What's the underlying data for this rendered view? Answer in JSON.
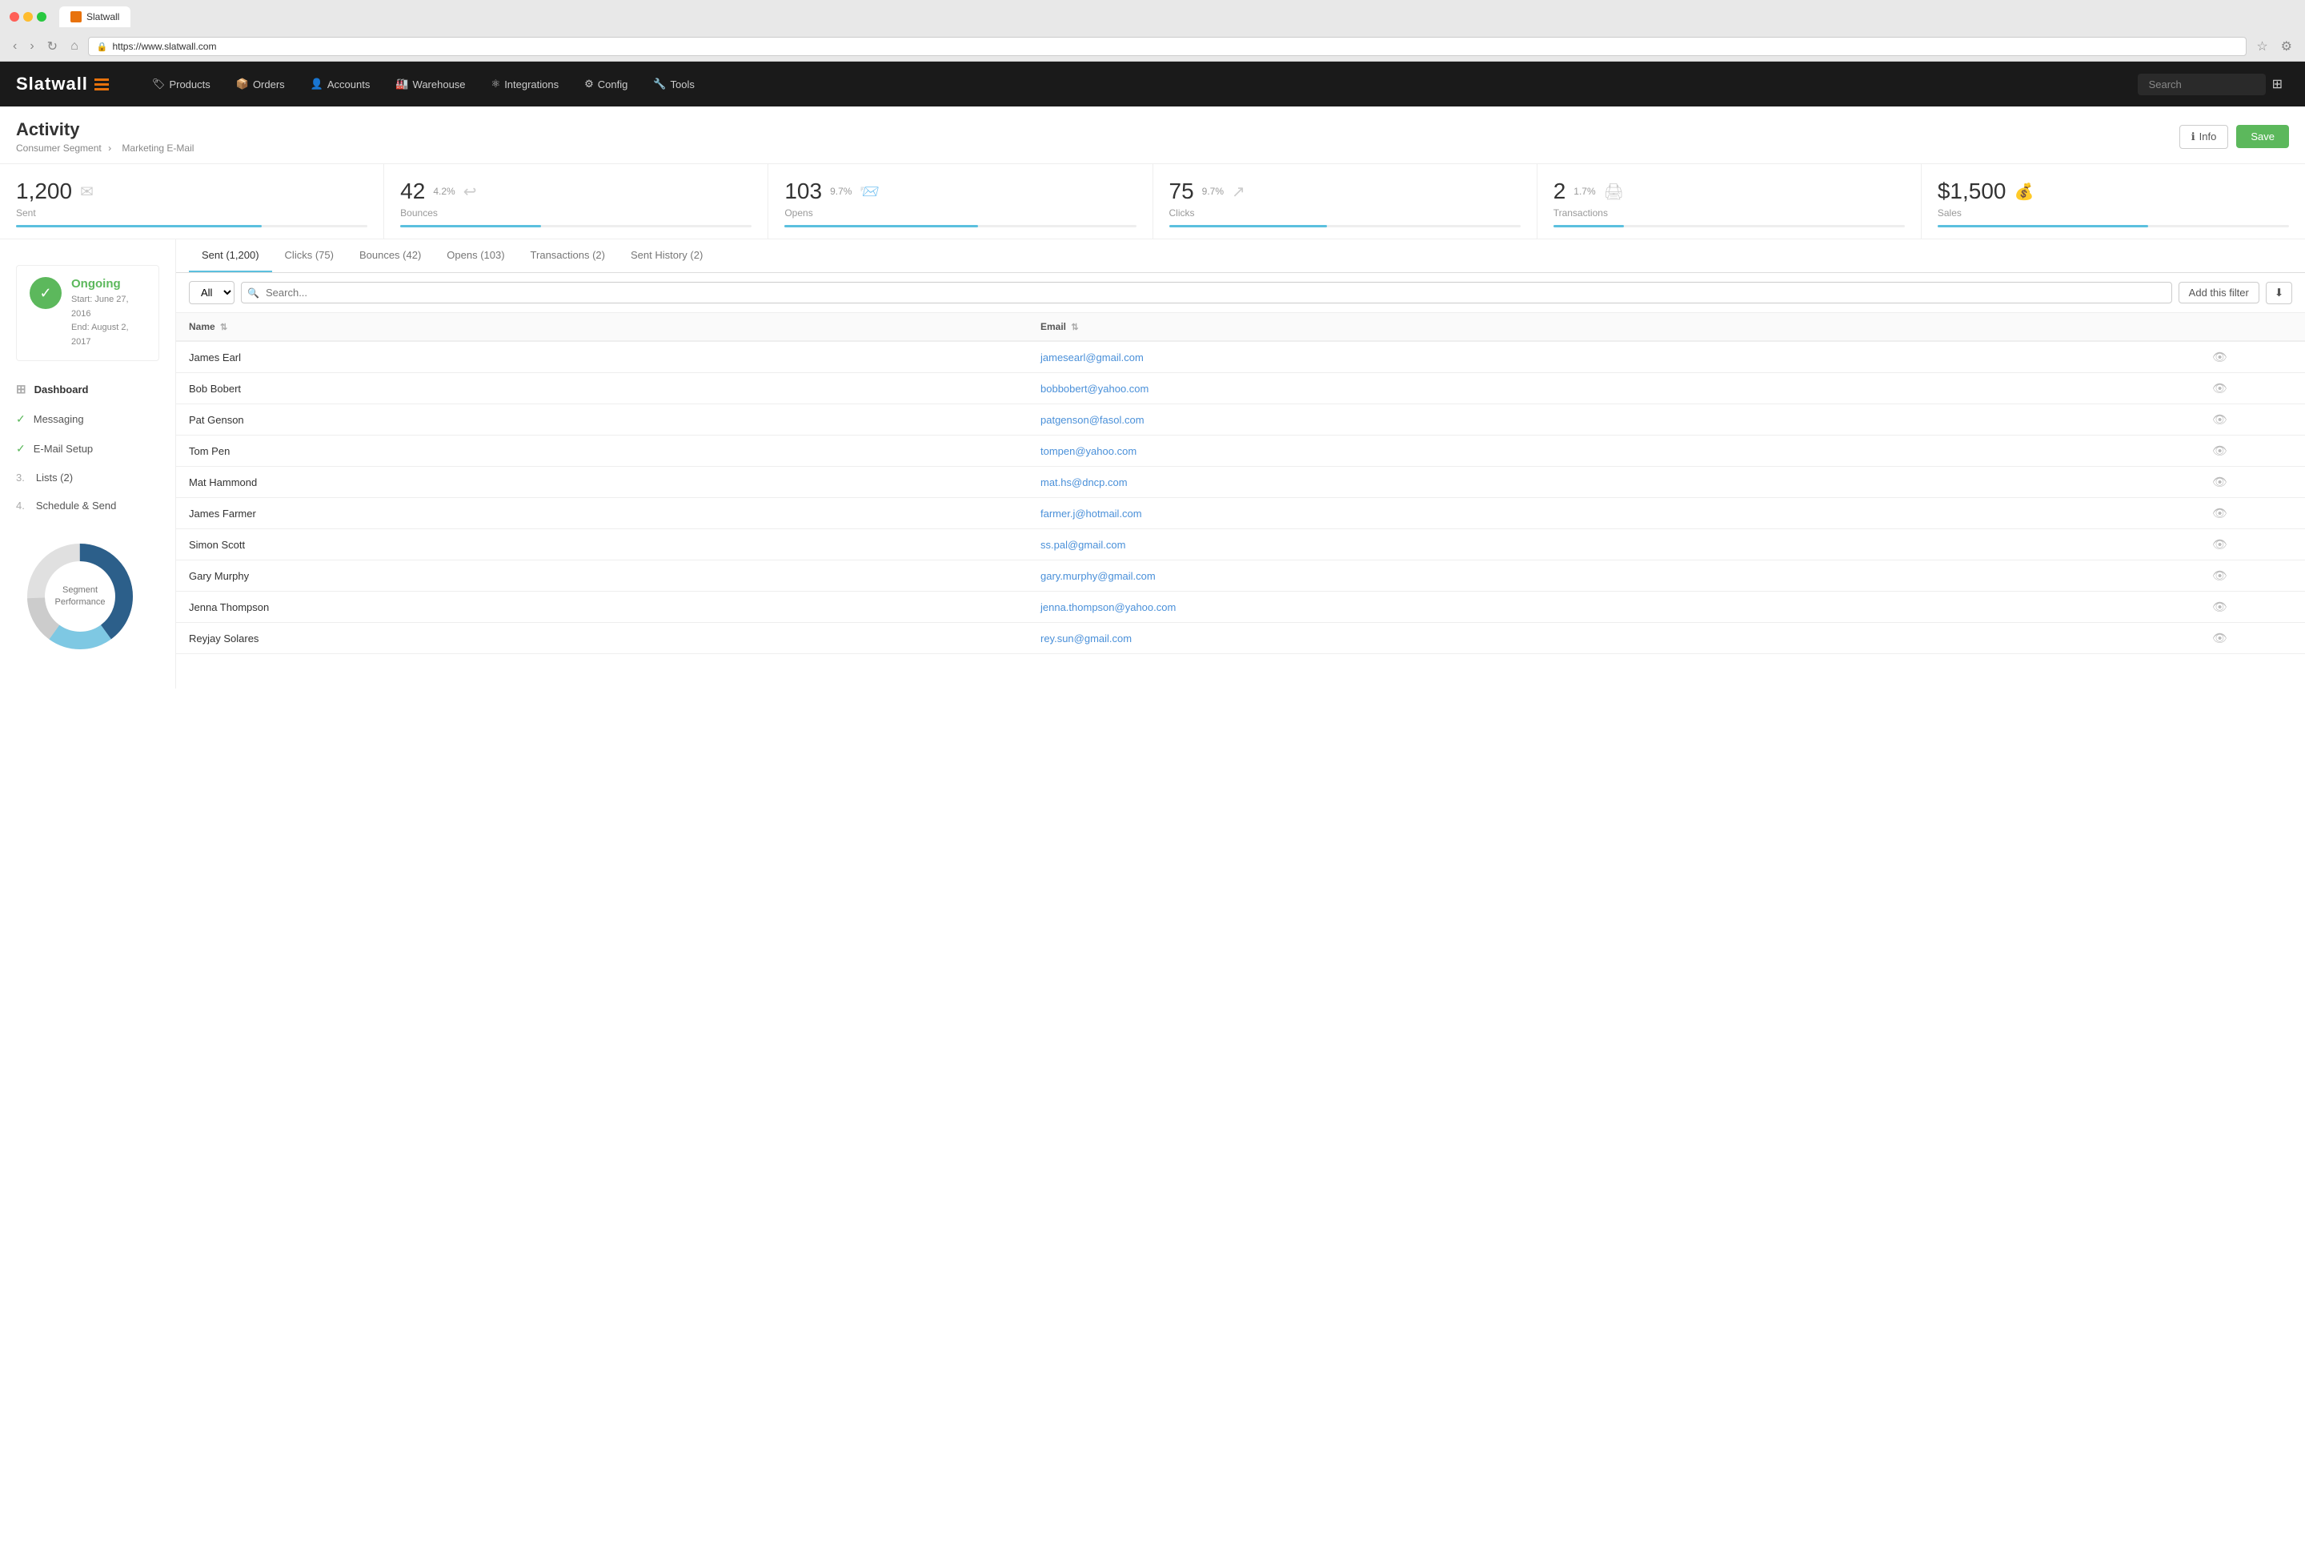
{
  "browser": {
    "url": "https://www.slatwall.com",
    "tab_title": "Slatwall"
  },
  "navbar": {
    "brand": "Slatwall",
    "nav_items": [
      {
        "label": "Products",
        "icon": "🏷"
      },
      {
        "label": "Orders",
        "icon": "📦"
      },
      {
        "label": "Accounts",
        "icon": "👤"
      },
      {
        "label": "Warehouse",
        "icon": "🏭"
      },
      {
        "label": "Integrations",
        "icon": "⚛"
      },
      {
        "label": "Config",
        "icon": "⚙"
      },
      {
        "label": "Tools",
        "icon": "🔧"
      }
    ],
    "search_placeholder": "Search"
  },
  "page": {
    "title": "Activity",
    "breadcrumb_parent": "Consumer Segment",
    "breadcrumb_child": "Marketing E-Mail",
    "btn_info": "Info",
    "btn_save": "Save"
  },
  "stats": [
    {
      "value": "1,200",
      "pct": "",
      "label": "Sent",
      "bar_width": "70",
      "bar_color": "#5bc0de"
    },
    {
      "value": "42",
      "pct": "4.2%",
      "label": "Bounces",
      "bar_width": "40",
      "bar_color": "#5bc0de"
    },
    {
      "value": "103",
      "pct": "9.7%",
      "label": "Opens",
      "bar_width": "55",
      "bar_color": "#5bc0de"
    },
    {
      "value": "75",
      "pct": "9.7%",
      "label": "Clicks",
      "bar_width": "45",
      "bar_color": "#5bc0de"
    },
    {
      "value": "2",
      "pct": "1.7%",
      "label": "Transactions",
      "bar_width": "20",
      "bar_color": "#5bc0de"
    },
    {
      "value": "$1,500",
      "pct": "",
      "label": "Sales",
      "bar_width": "60",
      "bar_color": "#5bc0de"
    }
  ],
  "sidebar": {
    "status_label": "Ongoing",
    "status_start": "Start: June 27, 2016",
    "status_end": "End: August 2, 2017",
    "items": [
      {
        "label": "Dashboard",
        "type": "icon",
        "number": ""
      },
      {
        "label": "Messaging",
        "type": "check",
        "number": ""
      },
      {
        "label": "E-Mail Setup",
        "type": "check",
        "number": ""
      },
      {
        "label": "Lists (2)",
        "type": "number",
        "number": "3."
      },
      {
        "label": "Schedule & Send",
        "type": "number",
        "number": "4."
      }
    ],
    "chart_label": "Segment Performance"
  },
  "tabs": [
    {
      "label": "Sent (1,200)",
      "active": true
    },
    {
      "label": "Clicks (75)",
      "active": false
    },
    {
      "label": "Bounces (42)",
      "active": false
    },
    {
      "label": "Opens (103)",
      "active": false
    },
    {
      "label": "Transactions (2)",
      "active": false
    },
    {
      "label": "Sent History (2)",
      "active": false
    }
  ],
  "filter": {
    "all_label": "All",
    "search_placeholder": "Search...",
    "add_filter_label": "Add this filter"
  },
  "table": {
    "col_name": "Name",
    "col_email": "Email",
    "rows": [
      {
        "name": "James Earl",
        "email": "jamesearl@gmail.com"
      },
      {
        "name": "Bob Bobert",
        "email": "bobbobert@yahoo.com"
      },
      {
        "name": "Pat Genson",
        "email": "patgenson@fasol.com"
      },
      {
        "name": "Tom Pen",
        "email": "tompen@yahoo.com"
      },
      {
        "name": "Mat Hammond",
        "email": "mat.hs@dncp.com"
      },
      {
        "name": "James Farmer",
        "email": "farmer.j@hotmail.com"
      },
      {
        "name": "Simon Scott",
        "email": "ss.pal@gmail.com"
      },
      {
        "name": "Gary Murphy",
        "email": "gary.murphy@gmail.com"
      },
      {
        "name": "Jenna Thompson",
        "email": "jenna.thompson@yahoo.com"
      },
      {
        "name": "Reyjay Solares",
        "email": "rey.sun@gmail.com"
      }
    ]
  }
}
